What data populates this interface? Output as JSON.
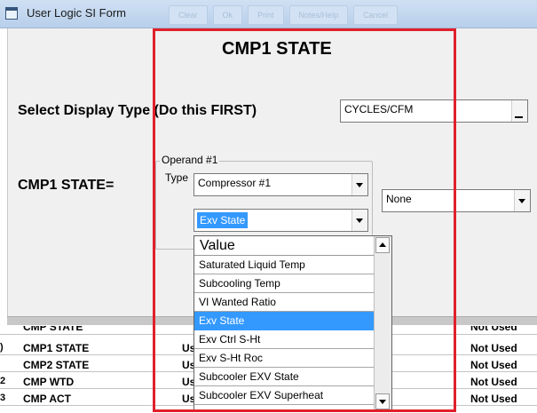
{
  "window": {
    "title": "User Logic SI Form",
    "ghost_tabs": [
      "Clear",
      "Ok",
      "Print",
      "Notes/Help",
      "Cancel"
    ]
  },
  "form": {
    "heading": "CMP1 STATE",
    "select_label": "Select Display Type (Do this FIRST)",
    "display_type_value": "CYCLES/CFM",
    "equation_label": "CMP1 STATE=",
    "operand": {
      "legend": "Operand #1",
      "type_label": "Type",
      "type_value": "Compressor #1",
      "field_value": "Exv State"
    },
    "operator_value": "None"
  },
  "dropdown": {
    "header": "Value",
    "items": [
      "Saturated Liquid Temp",
      "Subcooling Temp",
      "VI Wanted Ratio",
      "Exv State",
      "Exv Ctrl S-Ht",
      "Exv S-Ht Roc",
      "Subcooler EXV State",
      "Subcooler EXV Superheat"
    ],
    "selected_index": 3
  },
  "grid": {
    "partial_row": {
      "name": "CMP STATE",
      "status": "Not Used"
    },
    "rows": [
      {
        "mark": ")",
        "name": "CMP1 STATE",
        "group": "User L",
        "status": "Not Used"
      },
      {
        "mark": "",
        "name": "CMP2 STATE",
        "group": "User L",
        "status": "Not Used"
      },
      {
        "mark": "2",
        "name": "CMP WTD",
        "group": "User L",
        "status": "Not Used"
      },
      {
        "mark": "3",
        "name": "CMP ACT",
        "group": "User L",
        "status": "Not Used"
      }
    ]
  },
  "colors": {
    "highlight_border": "#e0202a",
    "selection": "#3399ff"
  }
}
